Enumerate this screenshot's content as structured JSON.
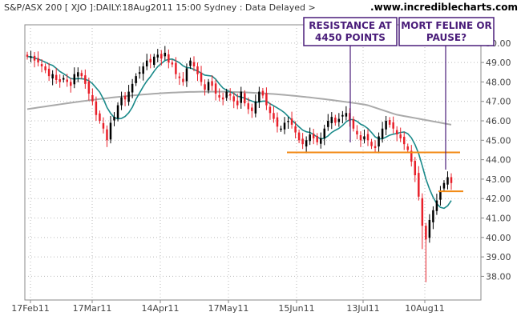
{
  "chart_data": {
    "type": "candlestick",
    "title": "S&P/ASX 200 [ XJO ]:DAILY:18Aug2011 15:00 Sydney : Data Delayed >",
    "site": ".www.incrediblecharts.com",
    "x_ticks": [
      "17Feb11",
      "17Mar11",
      "14Apr11",
      "17May11",
      "15Jun11",
      "13Jul11",
      "10Aug11"
    ],
    "y_ticks": [
      "38.00",
      "39.00",
      "40.00",
      "41.00",
      "42.00",
      "43.00",
      "44.00",
      "45.00",
      "46.00",
      "47.00",
      "48.00",
      "49.00",
      "50.00"
    ],
    "ylim": [
      37.5,
      50.3
    ],
    "grid": true,
    "annotations": [
      {
        "lines": [
          "RESISTANCE AT",
          "4450 POINTS"
        ]
      },
      {
        "lines": [
          "MORT FELINE OR",
          "PAUSE?"
        ]
      }
    ],
    "levels": [
      {
        "name": "resistance",
        "value": 44.5
      },
      {
        "name": "support",
        "value": 42.5
      }
    ],
    "colors": {
      "up": "#000000",
      "down": "#e8202a",
      "ma_short": "#1a8a8a",
      "ma_long": "#aaaaaa",
      "level": "#f28a14",
      "annotation": "#4a1d7a",
      "grid": "#bbbbbb"
    },
    "closes": [
      49.3,
      49.3,
      49.1,
      49.0,
      48.8,
      48.6,
      48.3,
      48.4,
      48.1,
      48.0,
      48.2,
      48.0,
      47.8,
      48.4,
      48.5,
      48.3,
      47.9,
      47.4,
      47.0,
      46.3,
      46.0,
      45.6,
      45.0,
      45.9,
      46.2,
      46.8,
      47.2,
      47.1,
      47.5,
      47.9,
      48.3,
      48.5,
      48.8,
      49.1,
      49.0,
      49.3,
      49.4,
      49.2,
      49.5,
      49.0,
      48.9,
      48.4,
      48.2,
      48.0,
      48.7,
      49.1,
      48.8,
      48.4,
      48.0,
      47.6,
      48.0,
      47.8,
      47.4,
      47.2,
      47.1,
      47.5,
      47.3,
      47.0,
      46.8,
      47.5,
      46.9,
      46.6,
      46.5,
      47.0,
      47.5,
      47.3,
      46.8,
      46.4,
      46.1,
      45.7,
      45.6,
      45.9,
      46.0,
      45.8,
      45.4,
      45.0,
      44.8,
      45.0,
      45.3,
      45.1,
      44.9,
      45.1,
      45.6,
      46.0,
      46.2,
      45.9,
      46.1,
      46.3,
      46.4,
      46.0,
      45.6,
      45.3,
      45.0,
      45.2,
      45.0,
      44.7,
      44.6,
      45.2,
      45.6,
      46.0,
      45.8,
      45.6,
      45.3,
      45.1,
      44.8,
      44.5,
      43.9,
      43.2,
      42.1,
      40.6,
      39.9,
      40.9,
      41.4,
      41.9,
      42.4,
      42.8,
      43.1,
      42.8
    ]
  }
}
